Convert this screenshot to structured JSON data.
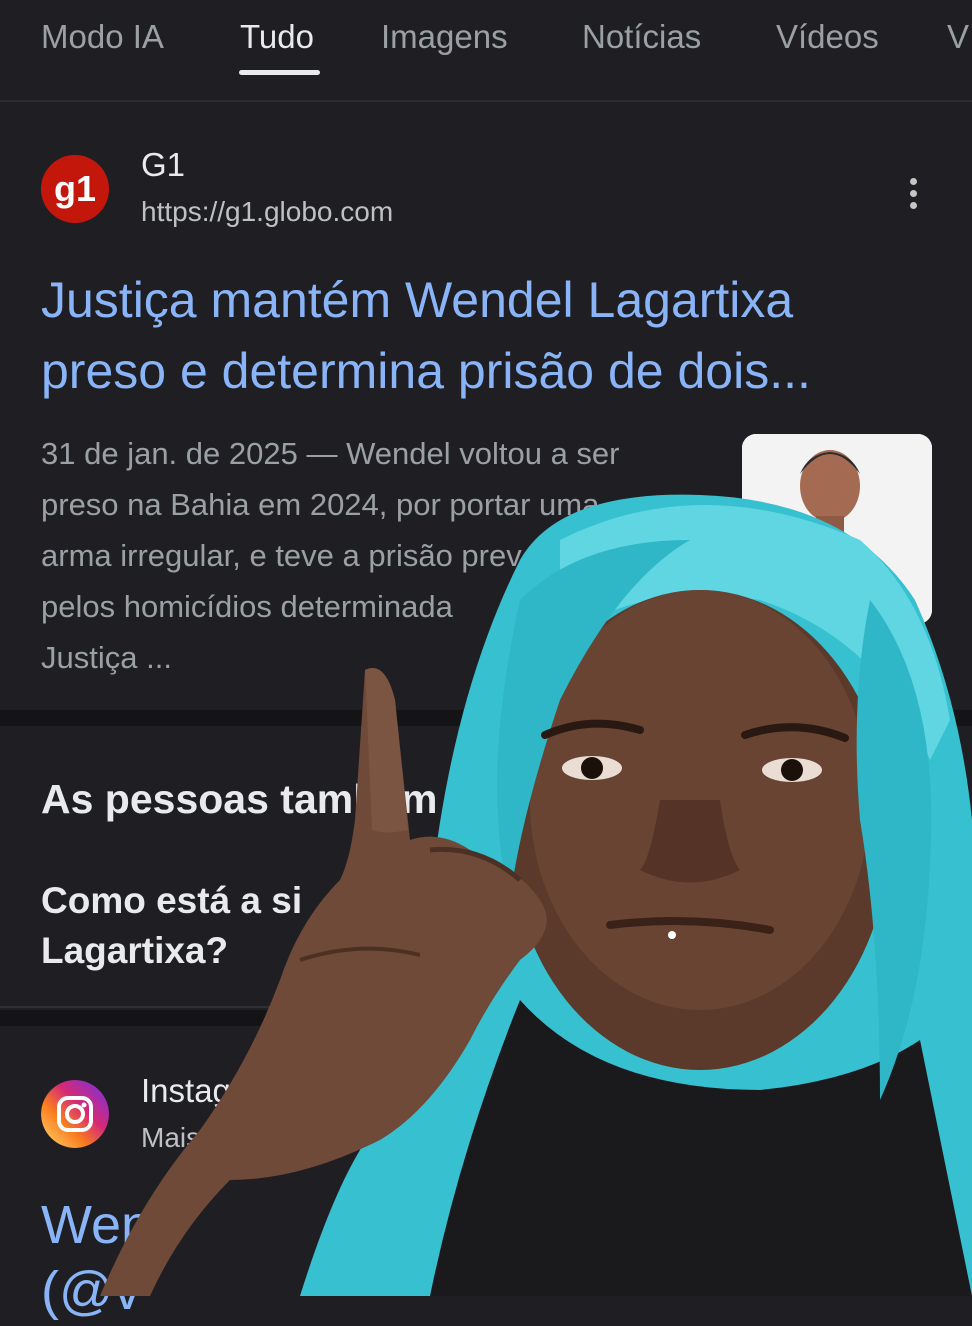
{
  "tabs": [
    {
      "label": "Modo IA"
    },
    {
      "label": "Tudo"
    },
    {
      "label": "Imagens"
    },
    {
      "label": "Notícias"
    },
    {
      "label": "Vídeos"
    },
    {
      "label": "V"
    }
  ],
  "results": [
    {
      "logo_text": "g1",
      "site": "G1",
      "url": "https://g1.globo.com",
      "title_line1": "Justiça mantém Wendel Lagartixa",
      "title_line2": "preso e determina prisão de dois...",
      "snippet": [
        "31 de jan. de 2025 — Wendel voltou a ser",
        "preso na Bahia em 2024, por portar uma",
        "arma irregular, e teve a prisão prev",
        "pelos homicídios determinada",
        "Justiça ..."
      ]
    }
  ],
  "paa": {
    "heading": "As pessoas também p",
    "question_line1": "Como está a si",
    "question_line2": "Lagartixa?"
  },
  "result2": {
    "site": "Instag",
    "sub": "Mais d",
    "title_line1": "Wenc",
    "title_line2": "(@v"
  },
  "colors": {
    "background": "#1f1f23",
    "link": "#8ab4f8",
    "g1_red": "#c4170c",
    "overlay_hair": "#3cc3d3"
  }
}
